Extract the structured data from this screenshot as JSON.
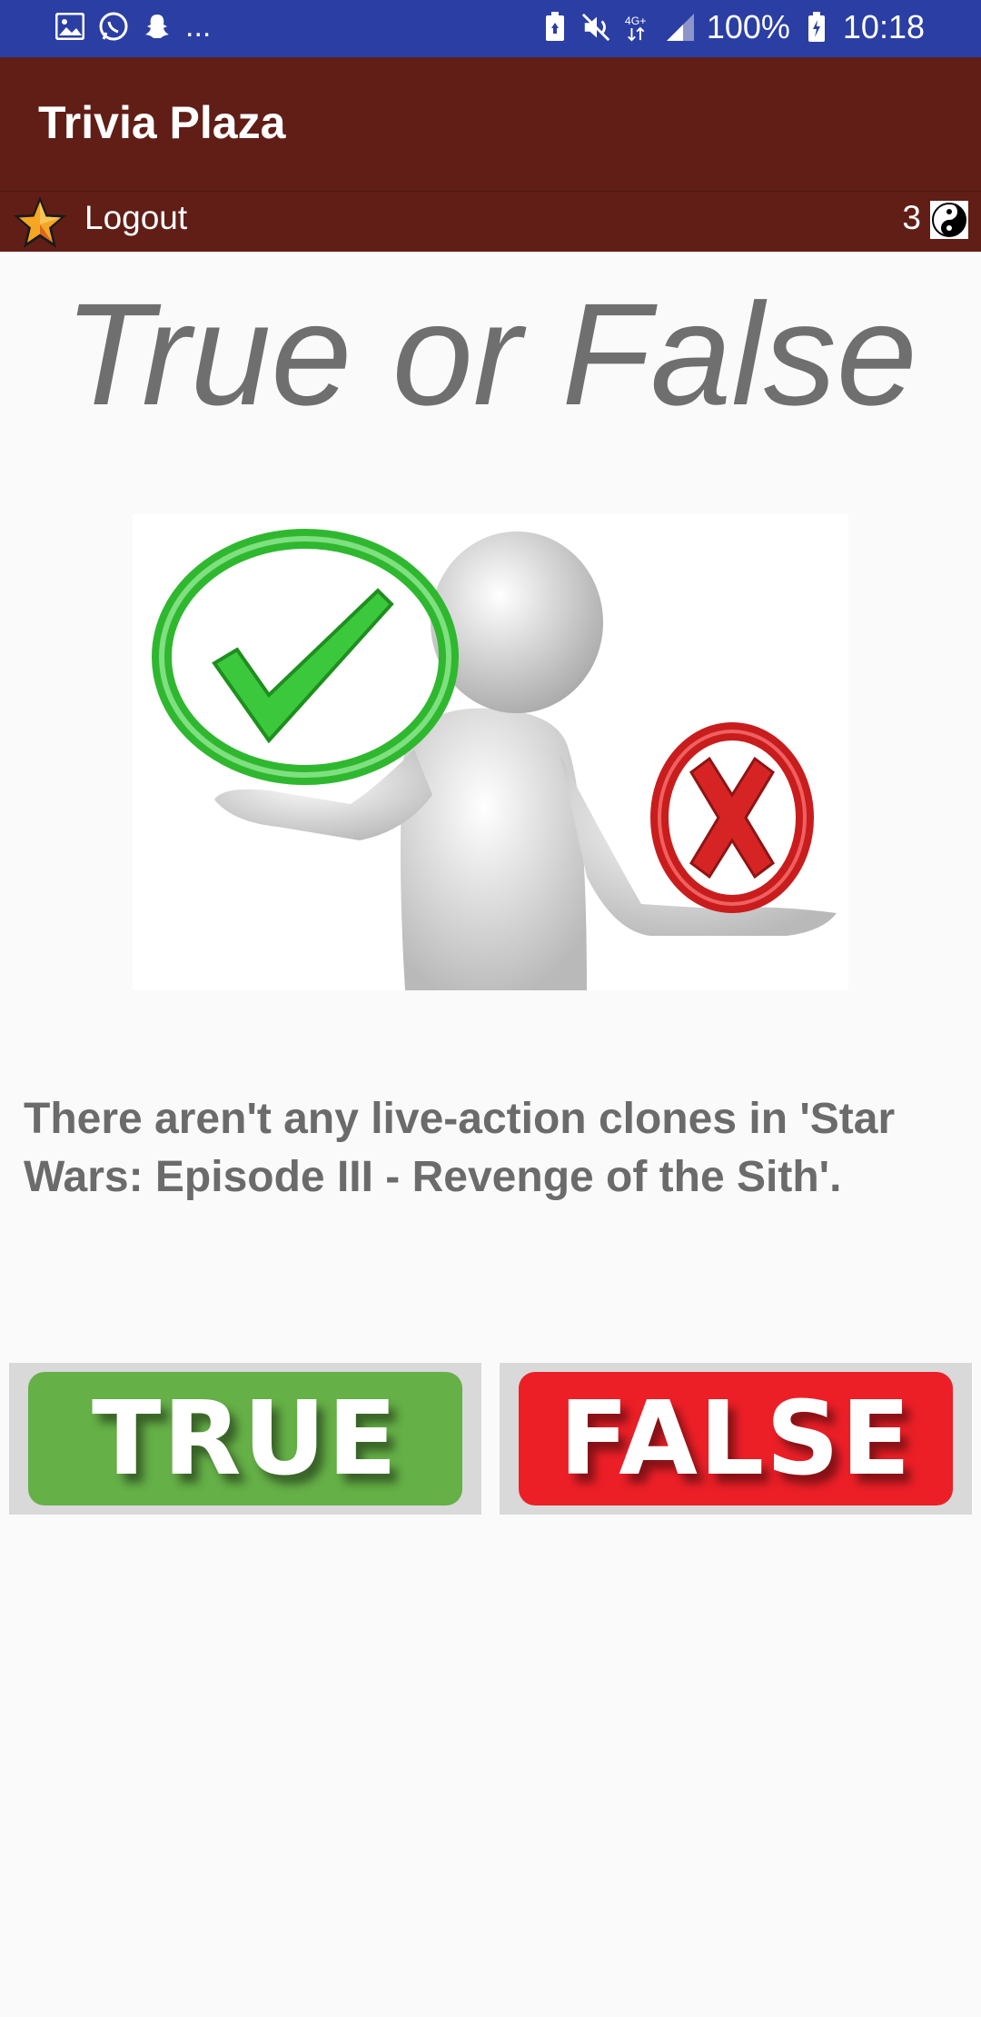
{
  "status_bar": {
    "left_icons": [
      "image-icon",
      "whatsapp-icon",
      "snapchat-icon"
    ],
    "overflow": "...",
    "right_icons": [
      "battery-saver-icon",
      "mute-icon",
      "network-4g-icon",
      "signal-icon"
    ],
    "battery": "100%",
    "time": "10:18"
  },
  "toolbar": {
    "title": "Trivia Plaza",
    "background": "#601e16"
  },
  "subbar": {
    "logout_label": "Logout",
    "coins": "3"
  },
  "main": {
    "heading": "True or False",
    "question": "There aren't any live-action clones in 'Star Wars: Episode III - Revenge of the Sith'."
  },
  "answers": {
    "true_label": "TRUE",
    "false_label": "FALSE",
    "true_color": "#65b047",
    "false_color": "#ec1f27"
  }
}
